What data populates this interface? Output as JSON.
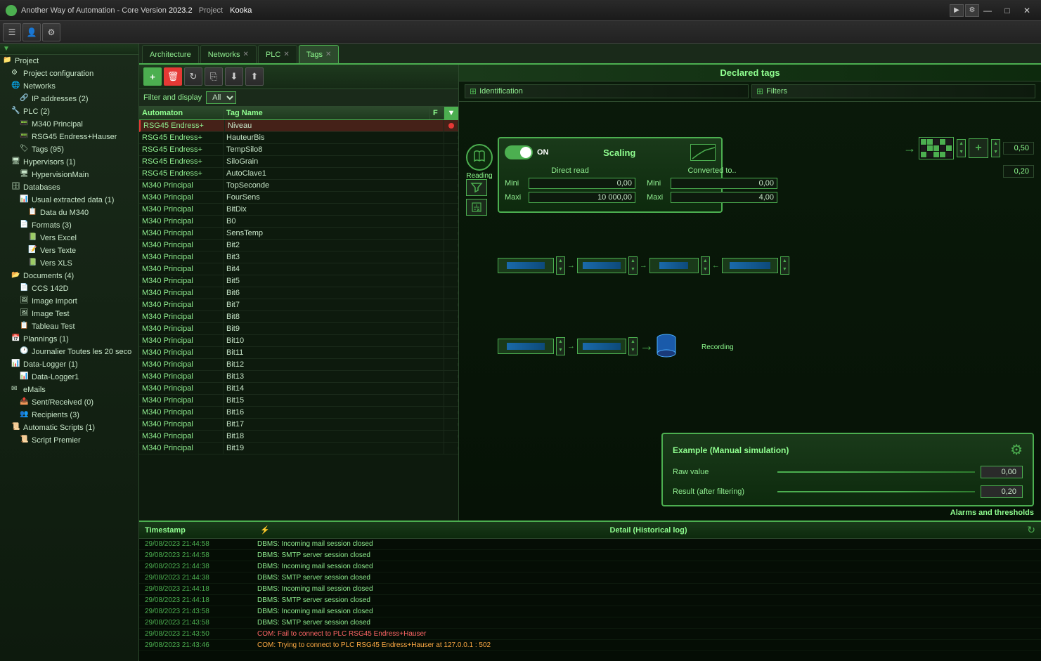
{
  "titlebar": {
    "app_name": "Another Way of Automation - Core Version",
    "version": "2023.2",
    "project_label": "Project",
    "project_name": "Kooka",
    "min_label": "—",
    "max_label": "□",
    "close_label": "✕"
  },
  "tabs": [
    {
      "label": "Architecture",
      "active": false,
      "closeable": false
    },
    {
      "label": "Networks",
      "active": false,
      "closeable": true
    },
    {
      "label": "PLC",
      "active": false,
      "closeable": true
    },
    {
      "label": "Tags",
      "active": true,
      "closeable": true
    }
  ],
  "toolbar": {
    "buttons": [
      "☰",
      "👤",
      "⚙"
    ]
  },
  "sidebar": {
    "items": [
      {
        "level": 0,
        "label": "Project",
        "icon": "📁",
        "expanded": true
      },
      {
        "level": 1,
        "label": "Project configuration",
        "icon": "⚙"
      },
      {
        "level": 1,
        "label": "Networks",
        "icon": "🌐",
        "expanded": true
      },
      {
        "level": 2,
        "label": "IP addresses (2)",
        "icon": "🔗"
      },
      {
        "level": 1,
        "label": "PLC (2)",
        "icon": "🔧",
        "expanded": true
      },
      {
        "level": 2,
        "label": "M340 Principal",
        "icon": "📟"
      },
      {
        "level": 2,
        "label": "RSG45 Endress+Hauser",
        "icon": "📟"
      },
      {
        "level": 2,
        "label": "Tags (95)",
        "icon": "🏷"
      },
      {
        "level": 1,
        "label": "Hypervisors (1)",
        "icon": "🖥",
        "expanded": true
      },
      {
        "level": 2,
        "label": "HypervisionMain",
        "icon": "🖥"
      },
      {
        "level": 1,
        "label": "Databases",
        "icon": "🗄",
        "expanded": true
      },
      {
        "level": 2,
        "label": "Usual extracted data (1)",
        "icon": "📊",
        "expanded": true
      },
      {
        "level": 3,
        "label": "Data du M340",
        "icon": "📋"
      },
      {
        "level": 2,
        "label": "Formats (3)",
        "icon": "📄",
        "expanded": true
      },
      {
        "level": 3,
        "label": "Vers Excel",
        "icon": "📗"
      },
      {
        "level": 3,
        "label": "Vers Texte",
        "icon": "📝"
      },
      {
        "level": 3,
        "label": "Vers XLS",
        "icon": "📗"
      },
      {
        "level": 1,
        "label": "Documents (4)",
        "icon": "📂",
        "expanded": true
      },
      {
        "level": 2,
        "label": "CCS 142D",
        "icon": "📄"
      },
      {
        "level": 2,
        "label": "Image Import",
        "icon": "🖼"
      },
      {
        "level": 2,
        "label": "Image Test",
        "icon": "🖼"
      },
      {
        "level": 2,
        "label": "Tableau Test",
        "icon": "📋"
      },
      {
        "level": 1,
        "label": "Plannings (1)",
        "icon": "📅",
        "expanded": true
      },
      {
        "level": 2,
        "label": "Journalier Toutes les 20 seco",
        "icon": "🕐"
      },
      {
        "level": 1,
        "label": "Data-Logger (1)",
        "icon": "📊",
        "expanded": true
      },
      {
        "level": 2,
        "label": "Data-Logger1",
        "icon": "📊"
      },
      {
        "level": 1,
        "label": "eMails",
        "icon": "✉",
        "expanded": true
      },
      {
        "level": 2,
        "label": "Sent/Received (0)",
        "icon": "📤"
      },
      {
        "level": 2,
        "label": "Recipients (3)",
        "icon": "👥"
      },
      {
        "level": 1,
        "label": "Automatic Scripts (1)",
        "icon": "📜",
        "expanded": true
      },
      {
        "level": 2,
        "label": "Script Premier",
        "icon": "📜"
      }
    ]
  },
  "tag_panel": {
    "filter_label": "Filter and display",
    "filter_value": "All",
    "col_automaton": "Automaton",
    "col_tagname": "Tag Name",
    "col_f": "F",
    "tags": [
      {
        "automaton": "RSG45 Endress+",
        "tagname": "Niveau",
        "flag": true,
        "selected": true
      },
      {
        "automaton": "RSG45 Endress+",
        "tagname": "HauteurBis",
        "flag": false
      },
      {
        "automaton": "RSG45 Endress+",
        "tagname": "TempSilo8",
        "flag": false
      },
      {
        "automaton": "RSG45 Endress+",
        "tagname": "SiloGrain",
        "flag": false
      },
      {
        "automaton": "RSG45 Endress+",
        "tagname": "AutoClave1",
        "flag": false
      },
      {
        "automaton": "M340 Principal",
        "tagname": "TopSeconde",
        "flag": false
      },
      {
        "automaton": "M340 Principal",
        "tagname": "FourSens",
        "flag": false
      },
      {
        "automaton": "M340 Principal",
        "tagname": "BitDix",
        "flag": false
      },
      {
        "automaton": "M340 Principal",
        "tagname": "B0",
        "flag": false
      },
      {
        "automaton": "M340 Principal",
        "tagname": "SensTemp",
        "flag": false
      },
      {
        "automaton": "M340 Principal",
        "tagname": "Bit2",
        "flag": false
      },
      {
        "automaton": "M340 Principal",
        "tagname": "Bit3",
        "flag": false
      },
      {
        "automaton": "M340 Principal",
        "tagname": "Bit4",
        "flag": false
      },
      {
        "automaton": "M340 Principal",
        "tagname": "Bit5",
        "flag": false
      },
      {
        "automaton": "M340 Principal",
        "tagname": "Bit6",
        "flag": false
      },
      {
        "automaton": "M340 Principal",
        "tagname": "Bit7",
        "flag": false
      },
      {
        "automaton": "M340 Principal",
        "tagname": "Bit8",
        "flag": false
      },
      {
        "automaton": "M340 Principal",
        "tagname": "Bit9",
        "flag": false
      },
      {
        "automaton": "M340 Principal",
        "tagname": "Bit10",
        "flag": false
      },
      {
        "automaton": "M340 Principal",
        "tagname": "Bit11",
        "flag": false
      },
      {
        "automaton": "M340 Principal",
        "tagname": "Bit12",
        "flag": false
      },
      {
        "automaton": "M340 Principal",
        "tagname": "Bit13",
        "flag": false
      },
      {
        "automaton": "M340 Principal",
        "tagname": "Bit14",
        "flag": false
      },
      {
        "automaton": "M340 Principal",
        "tagname": "Bit15",
        "flag": false
      },
      {
        "automaton": "M340 Principal",
        "tagname": "Bit16",
        "flag": false
      },
      {
        "automaton": "M340 Principal",
        "tagname": "Bit17",
        "flag": false
      },
      {
        "automaton": "M340 Principal",
        "tagname": "Bit18",
        "flag": false
      },
      {
        "automaton": "M340 Principal",
        "tagname": "Bit19",
        "flag": false
      }
    ]
  },
  "diagram": {
    "title": "Declared tags",
    "identification_label": "Identification",
    "filters_label": "Filters",
    "reading_label": "Reading",
    "scaling_label": "Scaling",
    "toggle_on_label": "ON",
    "direct_read_label": "Direct read",
    "converted_to_label": "Converted to..",
    "mini_label": "Mini",
    "maxi_label": "Maxi",
    "direct_mini": "0,00",
    "direct_maxi": "10 000,00",
    "converted_mini": "0,00",
    "converted_maxi": "4,00",
    "value_top_right1": "0,50",
    "value_top_right2": "0,20",
    "recording_label": "Recording",
    "alarms_label": "Alarms and thresholds"
  },
  "example_panel": {
    "title": "Example (Manual simulation)",
    "raw_value_label": "Raw value",
    "raw_value": "0,00",
    "result_label": "Result (after filtering)",
    "result_value": "0,20"
  },
  "log": {
    "col_timestamp": "Timestamp",
    "col_detail": "Detail (Historical log)",
    "entries": [
      {
        "ts": "29/08/2023 21:44:58",
        "detail": "DBMS: Incoming mail session closed",
        "type": "normal"
      },
      {
        "ts": "29/08/2023 21:44:58",
        "detail": "DBMS: SMTP server session closed",
        "type": "normal"
      },
      {
        "ts": "29/08/2023 21:44:38",
        "detail": "DBMS: Incoming mail session closed",
        "type": "normal"
      },
      {
        "ts": "29/08/2023 21:44:38",
        "detail": "DBMS: SMTP server session closed",
        "type": "normal"
      },
      {
        "ts": "29/08/2023 21:44:18",
        "detail": "DBMS: Incoming mail session closed",
        "type": "normal"
      },
      {
        "ts": "29/08/2023 21:44:18",
        "detail": "DBMS: SMTP server session closed",
        "type": "normal"
      },
      {
        "ts": "29/08/2023 21:43:58",
        "detail": "DBMS: Incoming mail session closed",
        "type": "normal"
      },
      {
        "ts": "29/08/2023 21:43:58",
        "detail": "DBMS: SMTP server session closed",
        "type": "normal"
      },
      {
        "ts": "29/08/2023 21:43:50",
        "detail": "COM: Fail to connect to PLC RSG45 Endress+Hauser",
        "type": "error"
      },
      {
        "ts": "29/08/2023 21:43:46",
        "detail": "COM: Trying to connect to PLC RSG45 Endress+Hauser at 127.0.0.1 : 502",
        "type": "warn"
      }
    ]
  }
}
